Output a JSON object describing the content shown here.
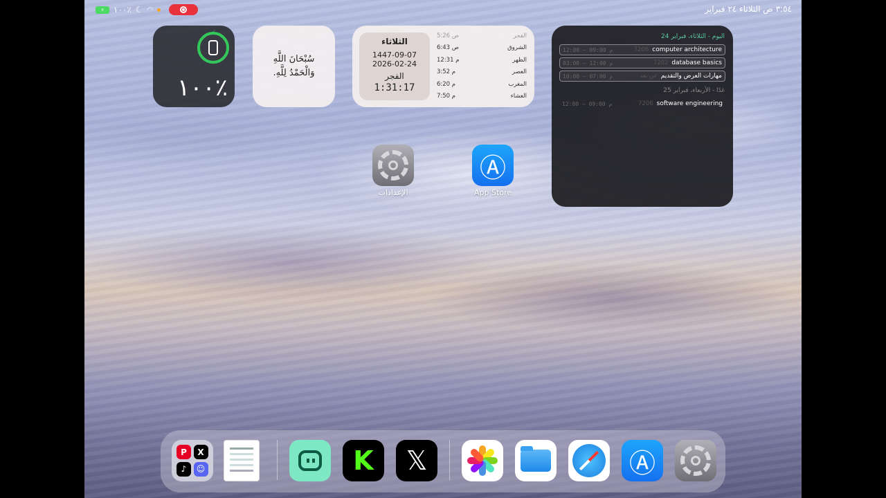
{
  "status_bar": {
    "battery_text": "١٠٠٪",
    "datetime": "٣:٥٤ ص  الثلاثاء ٢٤ فبراير"
  },
  "battery_widget": {
    "percent": "١٠٠٪",
    "level_fraction": 1.0,
    "ring_color": "#34c759"
  },
  "dhikr_widget": {
    "line1": "سُبْحَانَ اللَّهِ",
    "line2": "وَالْحَمْدُ لِلَّهِ."
  },
  "prayer_widget": {
    "day": "الثلاثاء",
    "hijri_date": "1447-09-07",
    "gregorian_date": "2026-02-24",
    "next_prayer": "الفجر",
    "countdown": "1:31:17",
    "prayers": [
      {
        "name": "الفجر",
        "time": "5:26 ص"
      },
      {
        "name": "الشروق",
        "time": "6:43 ص"
      },
      {
        "name": "الظهر",
        "time": "12:31 م"
      },
      {
        "name": "العصر",
        "time": "3:52 م"
      },
      {
        "name": "المغرب",
        "time": "6:20 م"
      },
      {
        "name": "العشاء",
        "time": "7:50 م"
      }
    ]
  },
  "calendar_widget": {
    "today_header": "اليوم - الثلاثاء، فبراير 24",
    "today_events": [
      {
        "title": "computer architecture",
        "room": "7206",
        "time": "12:00 – 09:00 م"
      },
      {
        "title": "database basics",
        "room": "7202",
        "time": "03:00 – 12:00 م"
      },
      {
        "title": "مهارات العرض والتقديم",
        "room": "عن بعد",
        "time": "10:00 – 07:00 م"
      }
    ],
    "tomorrow_header": "غدًا - الأربعاء، فبراير 25",
    "tomorrow_events": [
      {
        "title": "software engineering",
        "room": "7206",
        "time": "12:00 – 09:00 م"
      }
    ]
  },
  "home_apps": [
    {
      "label": "الإعدادات",
      "icon": "settings-icon"
    },
    {
      "label": "App Store",
      "icon": "app-store-icon"
    }
  ],
  "dock": {
    "apps": [
      {
        "name": "social-folder",
        "icon": "folder-icon"
      },
      {
        "name": "document",
        "icon": "document-icon"
      },
      {
        "name": "green-app",
        "icon": "green-app-icon"
      },
      {
        "name": "kick",
        "icon": "kick-icon",
        "glyph": "K"
      },
      {
        "name": "x",
        "icon": "x-icon",
        "glyph": "𝕏"
      },
      {
        "name": "photos",
        "icon": "photos-icon"
      },
      {
        "name": "files",
        "icon": "files-icon"
      },
      {
        "name": "safari",
        "icon": "safari-icon"
      },
      {
        "name": "app-store",
        "icon": "app-store-icon"
      },
      {
        "name": "settings",
        "icon": "settings-icon"
      }
    ]
  }
}
